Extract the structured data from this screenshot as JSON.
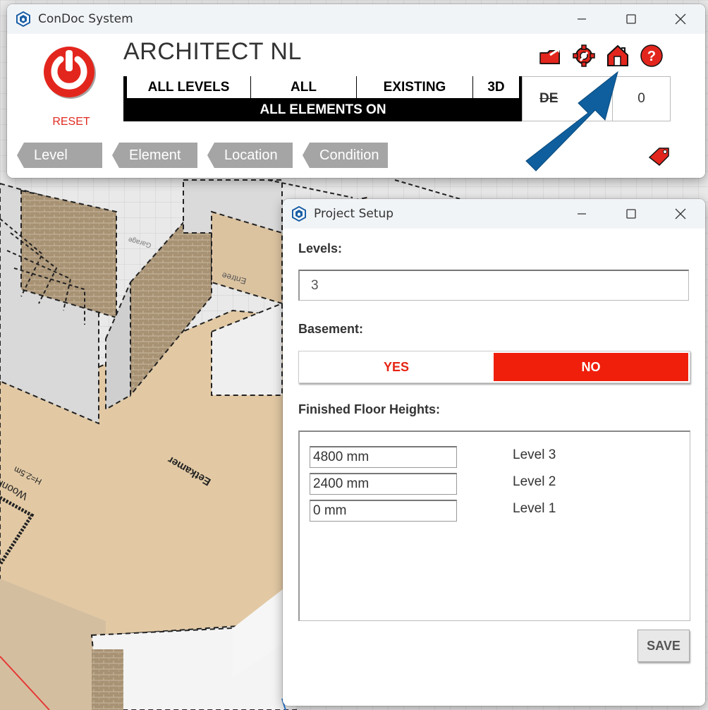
{
  "viewport": {
    "room_labels": [
      "Woonkamer",
      "H=2.5m",
      "Eetkamer",
      "Entree",
      "Garage"
    ]
  },
  "condoc_window": {
    "title": "ConDoc System",
    "reset_label": "RESET",
    "project_name": "ARCHITECT NL",
    "filters": {
      "levels": "ALL LEVELS",
      "elements": "ALL",
      "phase": "EXISTING",
      "view": "3D",
      "status": "ALL ELEMENTS ON"
    },
    "detail_label": "DE",
    "count_value": "0",
    "tabs": [
      "Level",
      "Element",
      "Location",
      "Condition"
    ],
    "toolbar_icons": [
      "open-folder-icon",
      "settings-gear-icon",
      "project-setup-house-icon",
      "help-icon"
    ]
  },
  "setup_window": {
    "title": "Project Setup",
    "levels_label": "Levels:",
    "levels_value": "3",
    "basement_label": "Basement:",
    "basement_yes": "YES",
    "basement_no": "NO",
    "basement_selected": "NO",
    "heights_label": "Finished Floor Heights:",
    "heights": [
      {
        "value": "4800 mm",
        "level": "Level 3"
      },
      {
        "value": "2400 mm",
        "level": "Level 2"
      },
      {
        "value": "0 mm",
        "level": "Level 1"
      }
    ],
    "save_label": "SAVE"
  },
  "colors": {
    "accent_red": "#e02c22",
    "arrow_blue": "#0f5f9e",
    "tab_gray": "#a5a5a5",
    "floor_tan": "#e2c9a4"
  }
}
